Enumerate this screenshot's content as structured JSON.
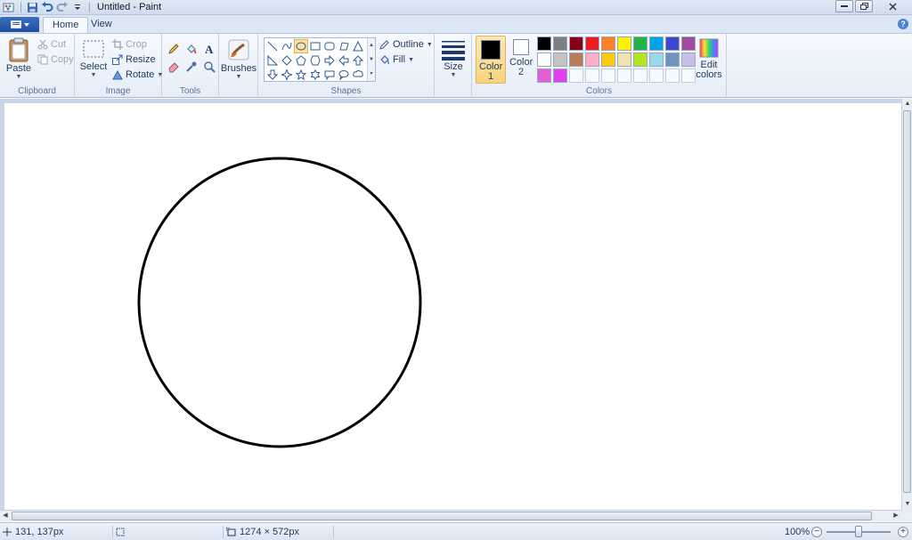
{
  "window": {
    "title": "Untitled - Paint"
  },
  "tabs": {
    "home": "Home",
    "view": "View"
  },
  "ribbon": {
    "clipboard": {
      "caption": "Clipboard",
      "paste": "Paste",
      "cut": "Cut",
      "copy": "Copy"
    },
    "image": {
      "caption": "Image",
      "select": "Select",
      "crop": "Crop",
      "resize": "Resize",
      "rotate": "Rotate"
    },
    "tools": {
      "caption": "Tools"
    },
    "brushes": {
      "label": "Brushes"
    },
    "shapes": {
      "caption": "Shapes",
      "outline": "Outline",
      "fill": "Fill",
      "selected_shape": "oval"
    },
    "size": {
      "label": "Size"
    },
    "colors": {
      "caption": "Colors",
      "color1_label": "Color 1",
      "color2_label": "Color 2",
      "color1_value": "#000000",
      "color2_value": "#ffffff",
      "edit_label": "Edit colors",
      "palette_row1": [
        "#000000",
        "#7f7f7f",
        "#880015",
        "#ed1c24",
        "#ff7f27",
        "#fff200",
        "#22b14c",
        "#00a2e8",
        "#3f48cc",
        "#a349a4"
      ],
      "palette_row2": [
        "#ffffff",
        "#c3c3c3",
        "#b97a57",
        "#ffaec9",
        "#ffc90e",
        "#efe4b0",
        "#b5e61d",
        "#99d9ea",
        "#7092be",
        "#c8bfe7"
      ],
      "palette_row3": [
        "#e35fd6",
        "#e040f0",
        "",
        "",
        "",
        "",
        "",
        "",
        "",
        ""
      ]
    }
  },
  "statusbar": {
    "cursor_pos": "131, 137px",
    "image_size": "1274 × 572px",
    "zoom": "100%"
  }
}
